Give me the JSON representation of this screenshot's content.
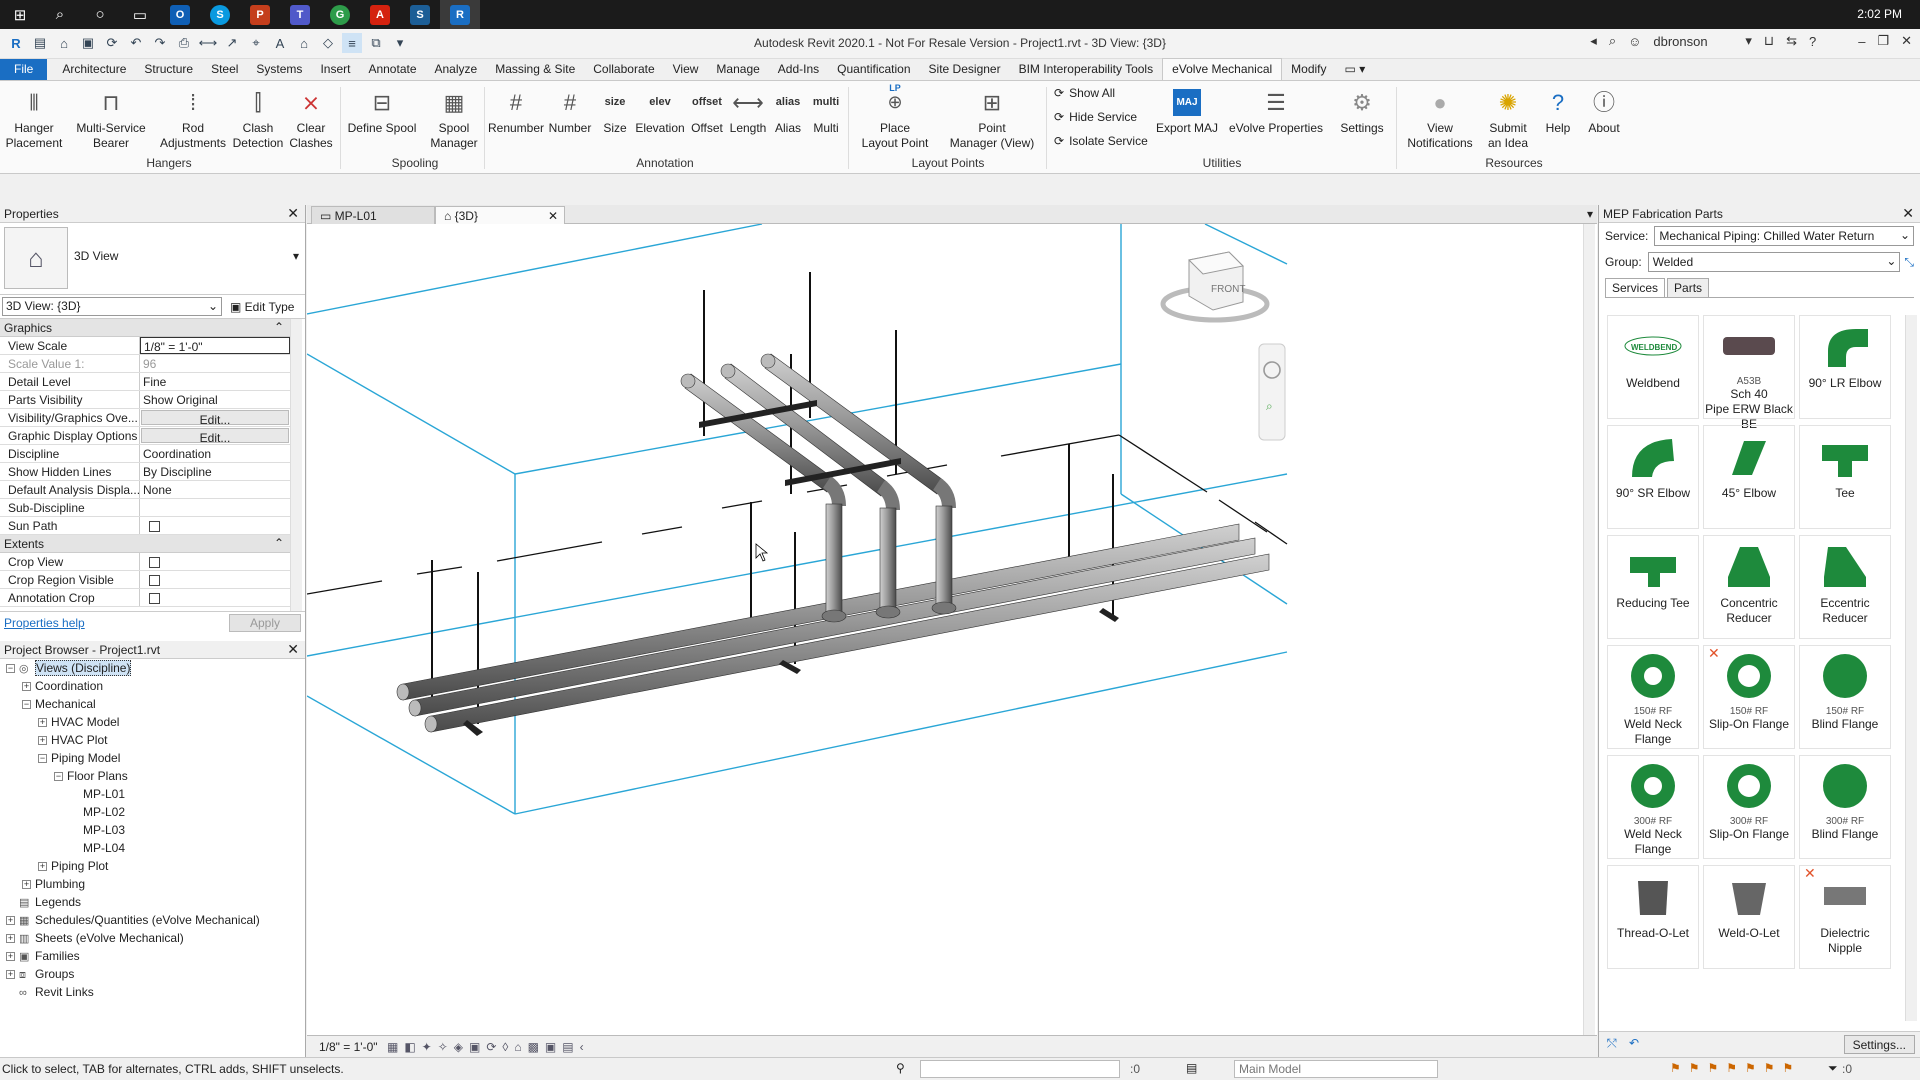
{
  "taskbar": {
    "time": "2:02 PM",
    "apps": [
      "O",
      "S",
      "P",
      "T",
      "G",
      "A",
      "S",
      "R"
    ]
  },
  "window": {
    "title": "Autodesk Revit 2020.1 - Not For Resale Version - Project1.rvt - 3D View: {3D}",
    "user": "dbronson"
  },
  "tabs": [
    "File",
    "Architecture",
    "Structure",
    "Steel",
    "Systems",
    "Insert",
    "Annotate",
    "Analyze",
    "Massing & Site",
    "Collaborate",
    "View",
    "Manage",
    "Add-Ins",
    "Quantification",
    "Site Designer",
    "BIM Interoperability Tools",
    "eVolve Mechanical",
    "Modify"
  ],
  "ribbon": {
    "hangers": {
      "group": "Hangers",
      "b1": "Hanger",
      "b1b": "Placement",
      "b2": "Multi-Service",
      "b2b": "Bearer",
      "b3": "Rod",
      "b3b": "Adjustments",
      "b4": "Clash",
      "b4b": "Detection",
      "b5": "Clear",
      "b5b": "Clashes"
    },
    "spooling": {
      "group": "Spooling",
      "b1": "Define Spool",
      "b2": "Spool",
      "b2b": "Manager"
    },
    "annotation": {
      "group": "Annotation",
      "b1": "Renumber",
      "b2": "Number",
      "b3": "Size",
      "b4": "Elevation",
      "b5": "Offset",
      "b6": "Length",
      "b7": "Alias",
      "b8": "Multi",
      "i3": "size",
      "i4": "elev",
      "i5": "offset",
      "i7": "alias",
      "i8": "multi"
    },
    "layout": {
      "group": "Layout Points",
      "b1": "Place",
      "b1b": "Layout Point",
      "b2": "Point",
      "b2b": "Manager (View)",
      "lp": "LP"
    },
    "utilities": {
      "group": "Utilities",
      "s1": "Show All",
      "s2": "Hide Service",
      "s3": "Isolate Service",
      "b1": "Export MAJ",
      "b2": "eVolve Properties",
      "b3": "Settings",
      "maj": "MAJ"
    },
    "resources": {
      "group": "Resources",
      "b1": "View",
      "b1b": "Notifications",
      "b2": "Submit",
      "b2b": "an Idea",
      "b3": "Help",
      "b4": "About"
    }
  },
  "properties": {
    "title": "Properties",
    "type_name": "3D View",
    "selector": "3D View: {3D}",
    "edit_type": "Edit Type",
    "graphics_section": "Graphics",
    "rows": [
      {
        "k": "View Scale",
        "v": "1/8\" = 1'-0\""
      },
      {
        "k": "Scale Value    1:",
        "v": "96"
      },
      {
        "k": "Detail Level",
        "v": "Fine"
      },
      {
        "k": "Parts Visibility",
        "v": "Show Original"
      },
      {
        "k": "Visibility/Graphics Ove...",
        "v": "Edit..."
      },
      {
        "k": "Graphic Display Options",
        "v": "Edit..."
      },
      {
        "k": "Discipline",
        "v": "Coordination"
      },
      {
        "k": "Show Hidden Lines",
        "v": "By Discipline"
      },
      {
        "k": "Default Analysis Displa...",
        "v": "None"
      },
      {
        "k": "Sub-Discipline",
        "v": ""
      },
      {
        "k": "Sun Path",
        "v": ""
      }
    ],
    "extents_section": "Extents",
    "extents": [
      "Crop View",
      "Crop Region Visible",
      "Annotation Crop"
    ],
    "help": "Properties help",
    "apply": "Apply"
  },
  "browser": {
    "title": "Project Browser - Project1.rvt",
    "items": [
      {
        "label": "Views (Discipline)",
        "lvl": 0,
        "exp": "−",
        "sel": true
      },
      {
        "label": "Coordination",
        "lvl": 1,
        "exp": "+"
      },
      {
        "label": "Mechanical",
        "lvl": 1,
        "exp": "−"
      },
      {
        "label": "HVAC Model",
        "lvl": 2,
        "exp": "+"
      },
      {
        "label": "HVAC Plot",
        "lvl": 2,
        "exp": "+"
      },
      {
        "label": "Piping Model",
        "lvl": 2,
        "exp": "−"
      },
      {
        "label": "Floor Plans",
        "lvl": 3,
        "exp": "−"
      },
      {
        "label": "MP-L01",
        "lvl": 4,
        "exp": ""
      },
      {
        "label": "MP-L02",
        "lvl": 4,
        "exp": ""
      },
      {
        "label": "MP-L03",
        "lvl": 4,
        "exp": ""
      },
      {
        "label": "MP-L04",
        "lvl": 4,
        "exp": ""
      },
      {
        "label": "Piping Plot",
        "lvl": 2,
        "exp": "+"
      },
      {
        "label": "Plumbing",
        "lvl": 1,
        "exp": "+"
      },
      {
        "label": "Legends",
        "lvl": 0,
        "exp": ""
      },
      {
        "label": "Schedules/Quantities (eVolve Mechanical)",
        "lvl": 0,
        "exp": "+"
      },
      {
        "label": "Sheets (eVolve Mechanical)",
        "lvl": 0,
        "exp": "+"
      },
      {
        "label": "Families",
        "lvl": 0,
        "exp": "+"
      },
      {
        "label": "Groups",
        "lvl": 0,
        "exp": "+"
      },
      {
        "label": "Revit Links",
        "lvl": 0,
        "exp": ""
      }
    ]
  },
  "view": {
    "tab1": "MP-L01",
    "tab2": "{3D}",
    "scale": "1/8\" = 1'-0\"",
    "viewcube": "FRONT"
  },
  "mep": {
    "title": "MEP Fabrication Parts",
    "service_label": "Service:",
    "service": "Mechanical Piping: Chilled Water Return",
    "group_label": "Group:",
    "group": "Welded",
    "tab_services": "Services",
    "tab_parts": "Parts",
    "parts": [
      {
        "sub": "",
        "name": "Weldbend",
        "name2": ""
      },
      {
        "sub": "A53B",
        "name": "Sch 40",
        "name2": "Pipe ERW Black BE"
      },
      {
        "sub": "",
        "name": "90° LR Elbow",
        "name2": ""
      },
      {
        "sub": "",
        "name": "90° SR Elbow",
        "name2": ""
      },
      {
        "sub": "",
        "name": "45° Elbow",
        "name2": ""
      },
      {
        "sub": "",
        "name": "Tee",
        "name2": ""
      },
      {
        "sub": "",
        "name": "Reducing Tee",
        "name2": ""
      },
      {
        "sub": "",
        "name": "Concentric",
        "name2": "Reducer"
      },
      {
        "sub": "",
        "name": "Eccentric",
        "name2": "Reducer"
      },
      {
        "sub": "150# RF",
        "name": "Weld Neck",
        "name2": "Flange"
      },
      {
        "sub": "150# RF",
        "name": "Slip-On Flange",
        "name2": ""
      },
      {
        "sub": "150# RF",
        "name": "Blind Flange",
        "name2": ""
      },
      {
        "sub": "300# RF",
        "name": "Weld Neck",
        "name2": "Flange"
      },
      {
        "sub": "300# RF",
        "name": "Slip-On Flange",
        "name2": ""
      },
      {
        "sub": "300# RF",
        "name": "Blind Flange",
        "name2": ""
      },
      {
        "sub": "",
        "name": "Thread-O-Let",
        "name2": ""
      },
      {
        "sub": "",
        "name": "Weld-O-Let",
        "name2": ""
      },
      {
        "sub": "",
        "name": "Dielectric",
        "name2": "Nipple"
      }
    ],
    "logo": "WELDBEND",
    "settings": "Settings..."
  },
  "status": {
    "hint": "Click to select, TAB for alternates, CTRL adds, SHIFT unselects.",
    "model": "Main Model",
    "zero1": ":0",
    "zero2": ":0"
  },
  "colors": {
    "accent": "#1a6ec3",
    "green": "#1e8a3c",
    "pipe": "#8d8d8d",
    "crop": "#2aa6d6"
  }
}
